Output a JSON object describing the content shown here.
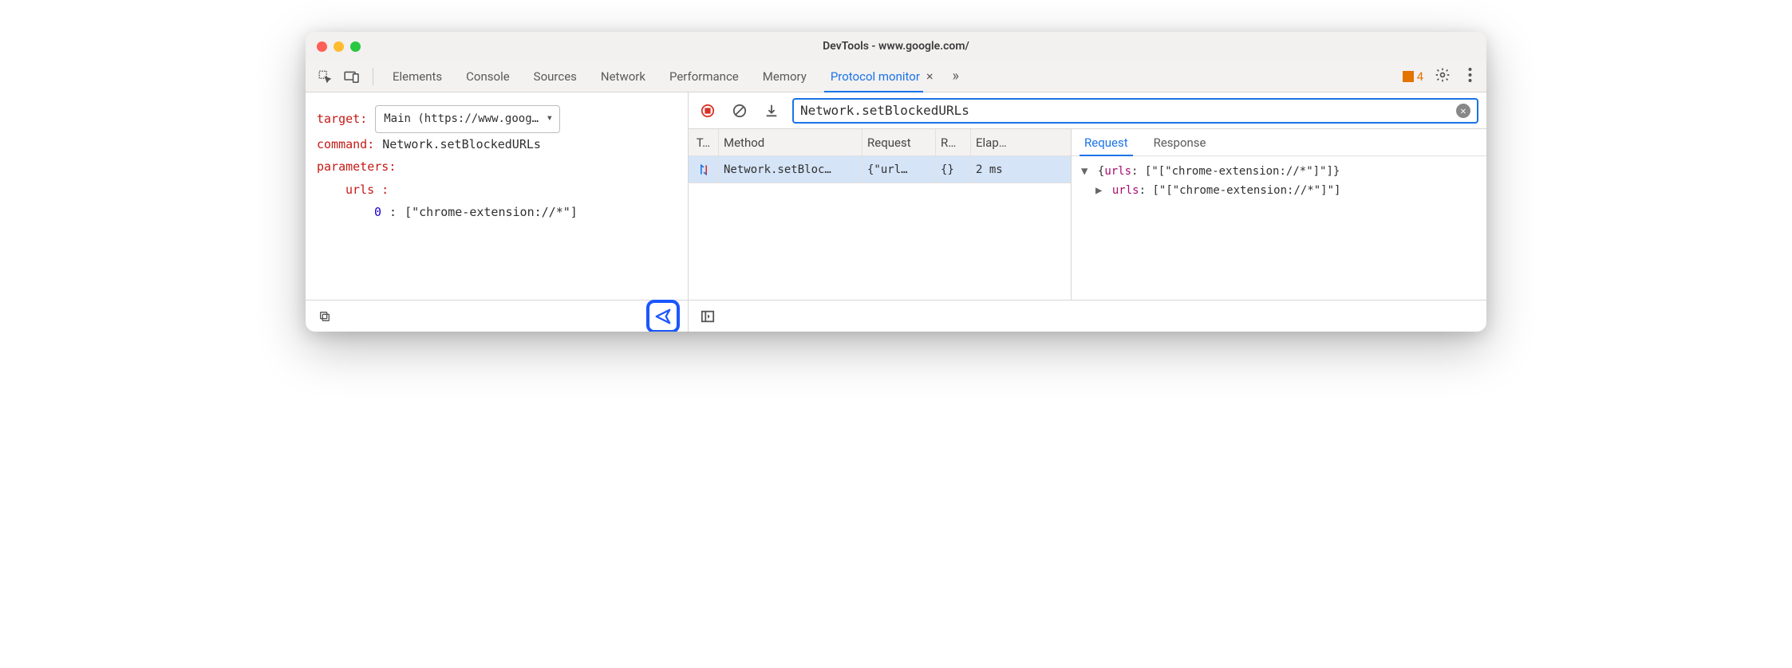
{
  "titlebar": {
    "title": "DevTools - www.google.com/"
  },
  "tabs": {
    "elements": "Elements",
    "console": "Console",
    "sources": "Sources",
    "network": "Network",
    "performance": "Performance",
    "memory": "Memory",
    "protocol_monitor": "Protocol monitor"
  },
  "issues": {
    "count": "4"
  },
  "left": {
    "target_label": "target",
    "target_value": "Main (https://www.goog…",
    "command_label": "command",
    "command_value": "Network.setBlockedURLs",
    "parameters_label": "parameters",
    "param_key": "urls",
    "param_index": "0",
    "param_value": "[\"chrome-extension://*\"]"
  },
  "search": {
    "value": "Network.setBlockedURLs"
  },
  "grid": {
    "headers": {
      "type": "T…",
      "method": "Method",
      "request": "Request",
      "response": "R…",
      "elapsed": "Elap…"
    },
    "rows": [
      {
        "method": "Network.setBloc…",
        "request": "{\"url…",
        "response": "{}",
        "elapsed": "2 ms"
      }
    ]
  },
  "detail": {
    "tabs": {
      "request": "Request",
      "response": "Response"
    },
    "line1_open": "{",
    "line1_prop": "urls",
    "line1_val": "[\"[\"chrome-extension://*\"]\"]",
    "line1_close": "}",
    "line2_prop": "urls",
    "line2_val": "[\"[\"chrome-extension://*\"]\"]"
  },
  "colon": ":"
}
